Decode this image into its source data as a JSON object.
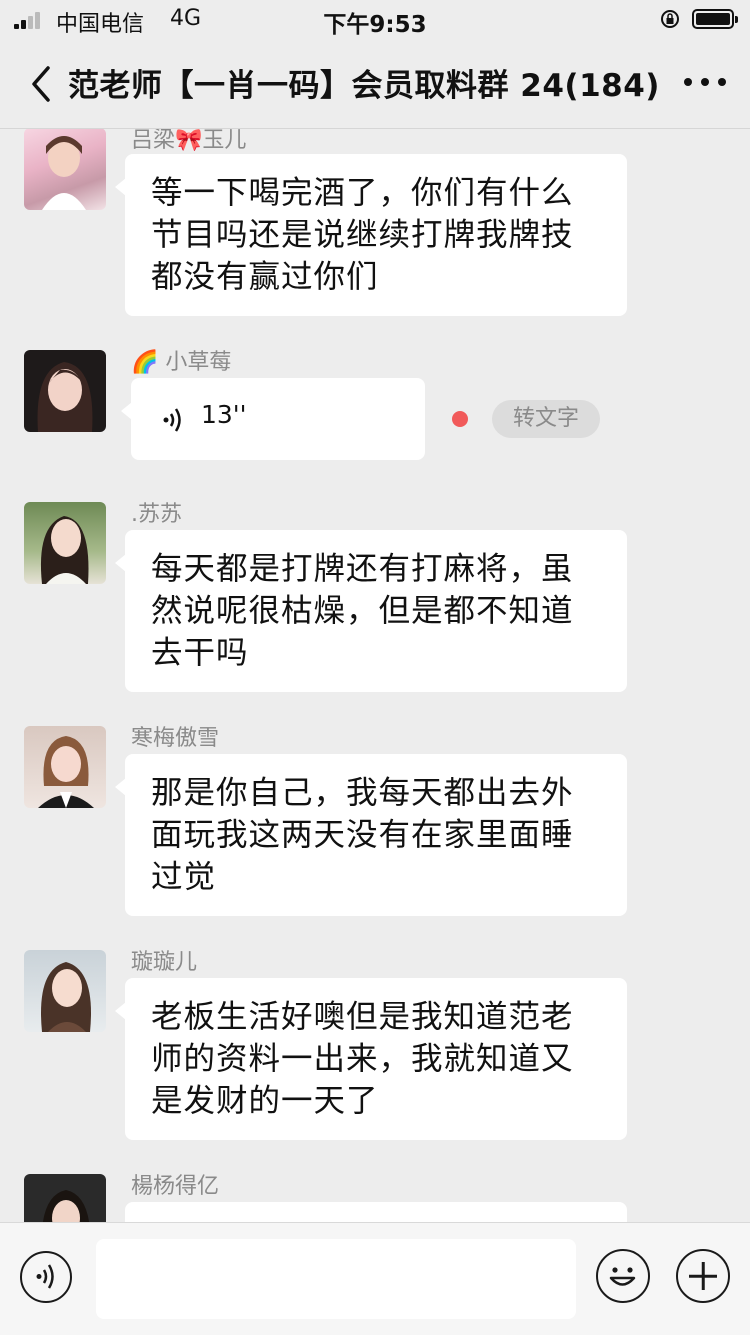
{
  "status_bar": {
    "carrier": "中国电信",
    "network": "4G",
    "time": "下午9:53"
  },
  "header": {
    "back_icon": "chevron-left-icon",
    "title": "范老师【一肖一码】会员取料群 24(184)",
    "more_icon": "more-dots-icon"
  },
  "messages": [
    {
      "sender": "吕梁🎀玉儿",
      "text": "等一下喝完酒了，你们有什么节目吗还是说继续打牌我牌技都没有赢过你们",
      "avatar": "avatar-photo"
    },
    {
      "sender": "🌈 小草莓",
      "type": "voice",
      "duration": "13''",
      "convert_label": "转文字",
      "unread": true,
      "avatar": "avatar-photo"
    },
    {
      "sender": ".苏苏",
      "text": "每天都是打牌还有打麻将，虽然说呢很枯燥，但是都不知道去干吗",
      "avatar": "avatar-photo"
    },
    {
      "sender": "寒梅傲雪",
      "text": "那是你自己，我每天都出去外面玩我这两天没有在家里面睡过觉",
      "avatar": "avatar-photo"
    },
    {
      "sender": "璇璇儿",
      "text": "老板生活好噢但是我知道范老师的资料一出来，我就知道又是发财的一天了",
      "avatar": "avatar-photo"
    },
    {
      "sender": "楊杨得亿",
      "text": "",
      "avatar": "avatar-photo"
    }
  ],
  "input_bar": {
    "voice_icon": "voice-mode-icon",
    "input_value": "",
    "emoji_icon": "emoji-icon",
    "plus_icon": "plus-icon"
  }
}
